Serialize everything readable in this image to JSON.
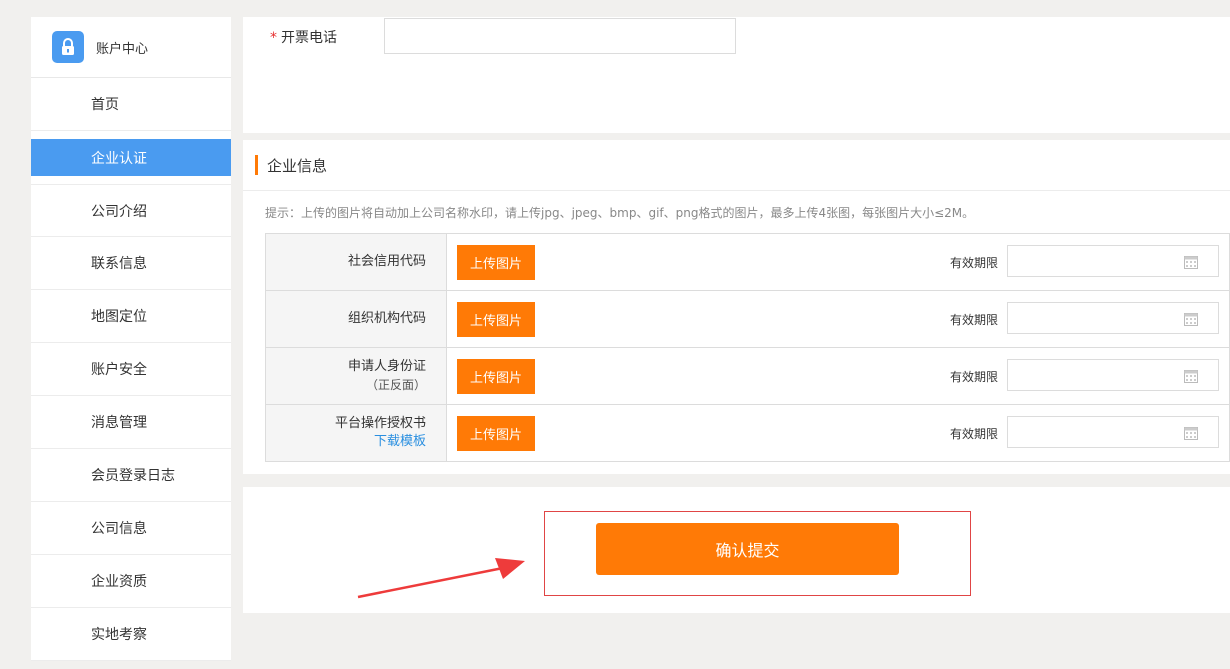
{
  "sidebar": {
    "title": "账户中心",
    "items": [
      {
        "label": "首页"
      },
      {
        "label": "企业认证",
        "active": true
      },
      {
        "label": "公司介绍"
      },
      {
        "label": "联系信息"
      },
      {
        "label": "地图定位"
      },
      {
        "label": "账户安全"
      },
      {
        "label": "消息管理"
      },
      {
        "label": "会员登录日志"
      },
      {
        "label": "公司信息"
      },
      {
        "label": "企业资质"
      },
      {
        "label": "实地考察"
      }
    ]
  },
  "invoice": {
    "required_mark": "*",
    "phone_label": "开票电话",
    "phone_value": ""
  },
  "company_info": {
    "title": "企业信息",
    "tip": "提示：上传的图片将自动加上公司名称水印，请上传jpg、jpeg、bmp、gif、png格式的图片，最多上传4张图，每张图片大小≤2M。",
    "upload_label": "上传图片",
    "valid_label": "有效期限",
    "rows": [
      {
        "label": "社会信用代码"
      },
      {
        "label": "组织机构代码"
      },
      {
        "label": "申请人身份证",
        "sub": "（正反面）"
      },
      {
        "label": "平台操作授权书",
        "link": "下载模板"
      }
    ]
  },
  "submit": {
    "label": "确认提交"
  },
  "colors": {
    "accent_orange": "#ff7a06",
    "sidebar_active": "#4a9bf0",
    "link_blue": "#2a8fe0",
    "highlight_red": "#e04545"
  }
}
